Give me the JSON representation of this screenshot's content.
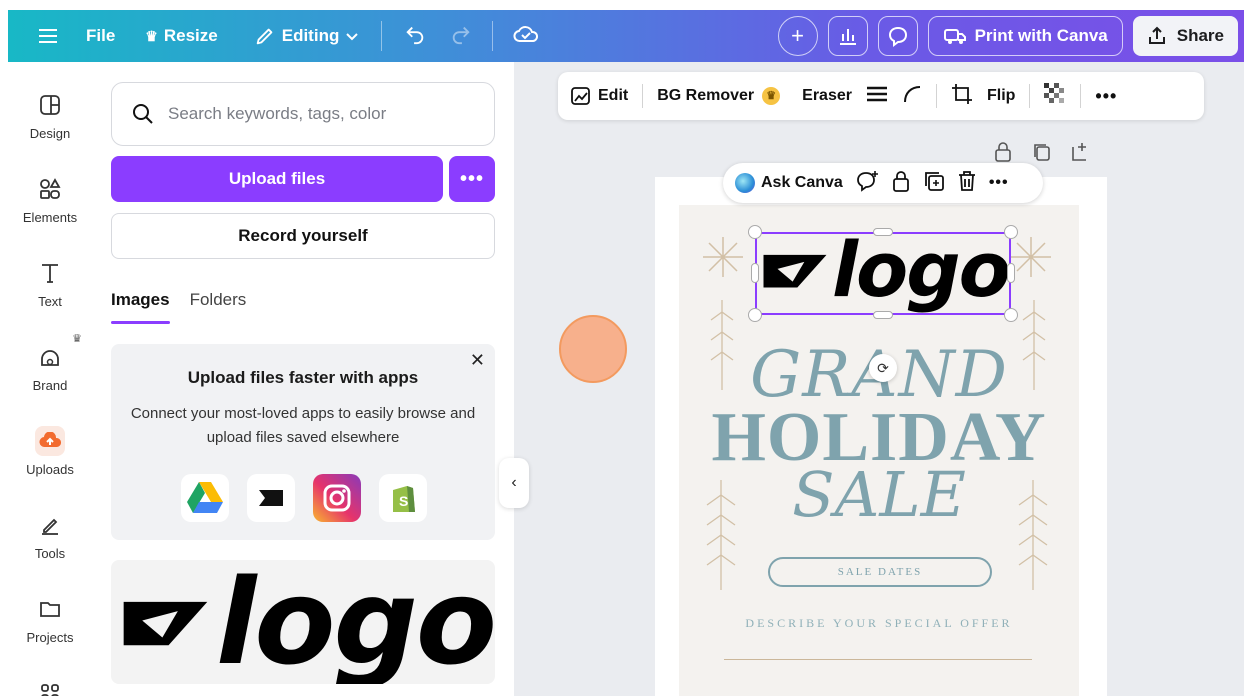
{
  "topbar": {
    "file_label": "File",
    "resize_label": "Resize",
    "editing_label": "Editing",
    "print_label": "Print with Canva",
    "share_label": "Share"
  },
  "rail": {
    "items": [
      {
        "label": "Design",
        "icon": "design-icon"
      },
      {
        "label": "Elements",
        "icon": "elements-icon"
      },
      {
        "label": "Text",
        "icon": "text-icon"
      },
      {
        "label": "Brand",
        "icon": "brand-icon"
      },
      {
        "label": "Uploads",
        "icon": "upload-cloud-icon"
      },
      {
        "label": "Tools",
        "icon": "tools-icon"
      },
      {
        "label": "Projects",
        "icon": "folder-icon"
      }
    ]
  },
  "panel": {
    "search_placeholder": "Search keywords, tags, color",
    "upload_label": "Upload files",
    "record_label": "Record yourself",
    "tabs": [
      "Images",
      "Folders"
    ],
    "promo_title": "Upload files faster with apps",
    "promo_desc": "Connect your most-loved apps to easily browse and upload files saved elsewhere",
    "apps": [
      "google-drive-icon",
      "dropbox-icon",
      "instagram-icon",
      "shopify-icon"
    ],
    "thumb_text": "logo"
  },
  "context_toolbar": {
    "edit_label": "Edit",
    "bg_remover_label": "BG Remover",
    "eraser_label": "Eraser",
    "flip_label": "Flip"
  },
  "ask_bar": {
    "label": "Ask Canva"
  },
  "flyer": {
    "logo_text": "logo",
    "line1": "GRAND",
    "line2": "HOLIDAY",
    "line3": "SALE",
    "dates": "SALE DATES",
    "offer": "DESCRIBE YOUR SPECIAL OFFER"
  },
  "colors": {
    "accent": "#8b3dff",
    "flyer_text": "#7fa3ad"
  }
}
